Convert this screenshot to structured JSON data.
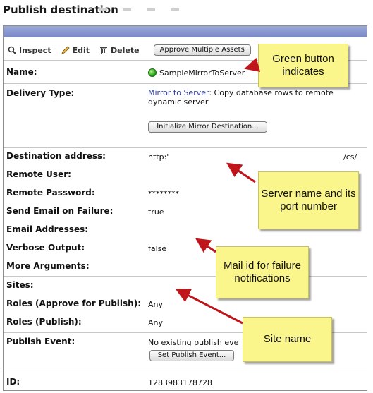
{
  "page": {
    "title": "Publish destination"
  },
  "toolbar": {
    "inspect_label": "Inspect",
    "edit_label": "Edit",
    "delete_label": "Delete",
    "approve_label": "Approve Multiple Assets"
  },
  "fields": {
    "name": {
      "label": "Name:",
      "value": "SampleMirrorToServer",
      "status_color": "#2ea81e"
    },
    "delivery_type": {
      "label": "Delivery Type:",
      "link": "Mirror to Server",
      "description": ": Copy database rows to remote dynamic server",
      "button": "Initialize Mirror Destination..."
    },
    "destination_address": {
      "label": "Destination address:",
      "value_prefix": "http:'",
      "value_suffix": "/cs/"
    },
    "remote_user": {
      "label": "Remote User:",
      "value": ""
    },
    "remote_password": {
      "label": "Remote Password:",
      "value": "********"
    },
    "send_email": {
      "label": "Send Email on Failure:",
      "value": "true"
    },
    "email_addresses": {
      "label": "Email Addresses:",
      "value": ""
    },
    "verbose_output": {
      "label": "Verbose Output:",
      "value": "false"
    },
    "more_arguments": {
      "label": "More Arguments:",
      "value": ""
    },
    "sites": {
      "label": "Sites:",
      "value": ""
    },
    "roles_approve": {
      "label": "Roles (Approve for Publish):",
      "value": "Any"
    },
    "roles_publish": {
      "label": "Roles (Publish):",
      "value": "Any"
    },
    "publish_event": {
      "label": "Publish Event:",
      "value": "No existing publish eve",
      "button": "Set Publish Event..."
    },
    "id": {
      "label": "ID:",
      "value": "1283983178728"
    }
  },
  "callouts": {
    "green_button": "Green button indicates",
    "server_name": "Server name and its port number",
    "mail_id": "Mail id for failure notifications",
    "site_name": "Site name"
  },
  "colors": {
    "header_bar": "#7a8ac8",
    "callout_bg": "#fbf68b",
    "arrow": "#c0161b",
    "link": "#2a3b9c"
  }
}
